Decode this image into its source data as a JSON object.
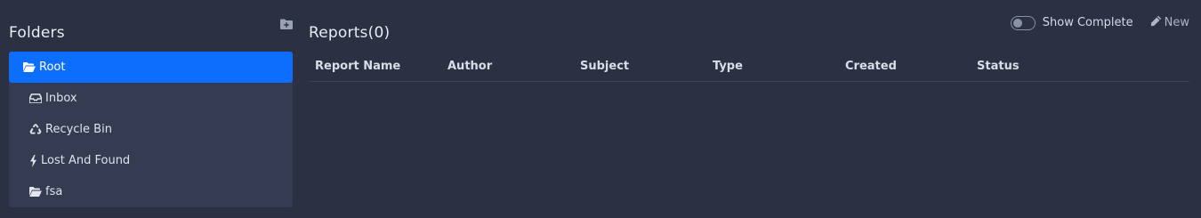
{
  "sidebar": {
    "title": "Folders",
    "add_folder_icon": "folder-plus-icon",
    "items": [
      {
        "label": "Root",
        "icon": "folder-open-icon",
        "active": true
      },
      {
        "label": "Inbox",
        "icon": "inbox-icon"
      },
      {
        "label": "Recycle Bin",
        "icon": "recycle-icon"
      },
      {
        "label": "Lost And Found",
        "icon": "bolt-icon"
      },
      {
        "label": "fsa",
        "icon": "folder-open-icon"
      }
    ]
  },
  "main": {
    "title": "Reports(0)",
    "toolbar": {
      "show_complete_label": "Show Complete",
      "show_complete_on": false,
      "new_label": "New",
      "new_icon": "pencil-icon"
    },
    "table": {
      "columns": [
        "Report Name",
        "Author",
        "Subject",
        "Type",
        "Created",
        "Status"
      ],
      "rows": []
    }
  },
  "colors": {
    "background": "#2b3042",
    "sidebar_panel": "#353b50",
    "active_item": "#0d6efd"
  }
}
